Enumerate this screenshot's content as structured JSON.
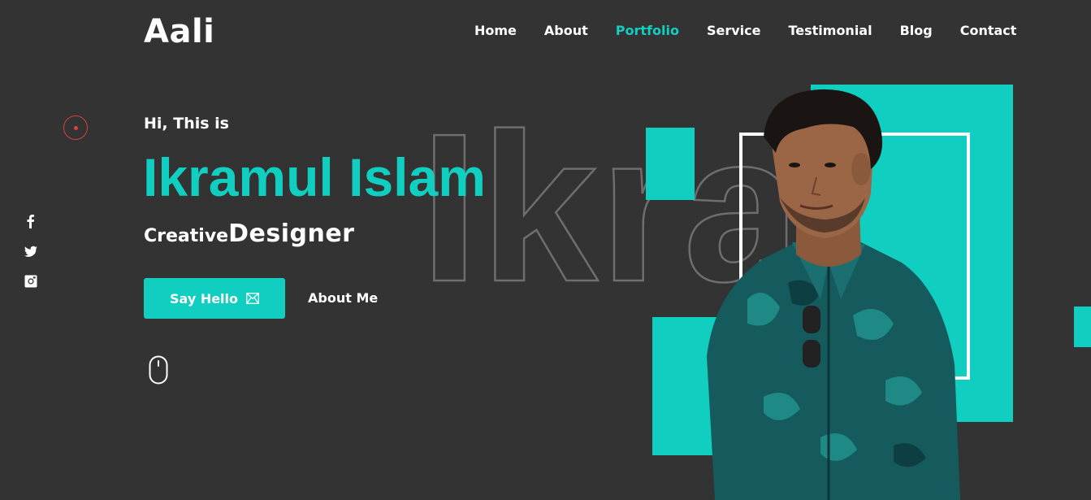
{
  "brand": {
    "logo_text": "Aali"
  },
  "nav": {
    "items": [
      {
        "label": "Home",
        "active": false
      },
      {
        "label": "About",
        "active": false
      },
      {
        "label": "Portfolio",
        "active": true
      },
      {
        "label": "Service",
        "active": false
      },
      {
        "label": "Testimonial",
        "active": false
      },
      {
        "label": "Blog",
        "active": false
      },
      {
        "label": "Contact",
        "active": false
      }
    ]
  },
  "social": [
    "facebook-icon",
    "twitter-icon",
    "instagram-icon"
  ],
  "hero": {
    "greeting": "Hi, This is",
    "name": "Ikramul Islam",
    "role_prefix": "Creative",
    "role_main": "Designer",
    "outline_text": "Ikram",
    "primary_button": {
      "label": "Say Hello",
      "icon": "envelope-icon"
    },
    "secondary_link": "About Me"
  },
  "colors": {
    "background": "#333333",
    "accent": "#11cfc0",
    "text": "#ffffff",
    "marker": "#d94040"
  }
}
